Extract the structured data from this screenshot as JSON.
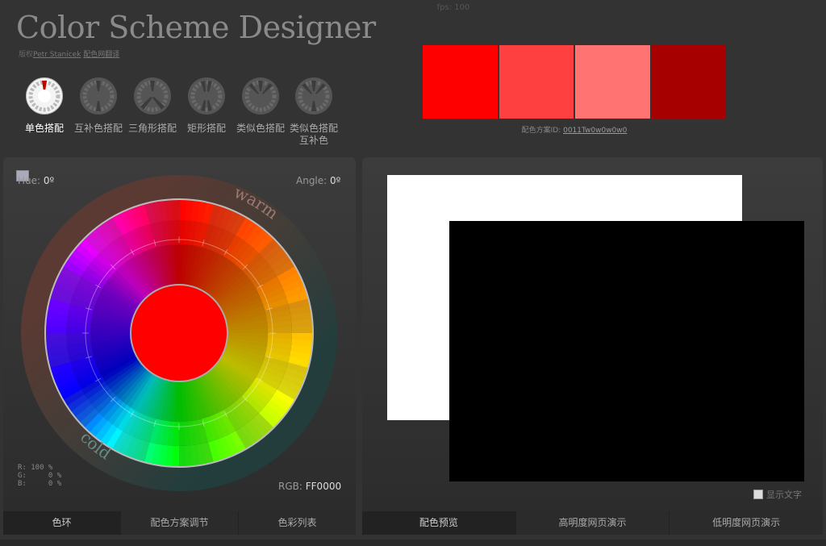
{
  "fps": "fps: 100",
  "app_title": "Color Scheme Designer",
  "credits": {
    "prefix": "版权",
    "author": "Petr Stanicek",
    "link": "配色网翻译"
  },
  "modes": [
    {
      "label": "单色搭配",
      "active": true
    },
    {
      "label": "互补色搭配",
      "active": false
    },
    {
      "label": "三角形搭配",
      "active": false
    },
    {
      "label": "矩形搭配",
      "active": false
    },
    {
      "label": "类似色搭配",
      "active": false
    },
    {
      "label": "类似色搭配互补色",
      "active": false
    }
  ],
  "palette": [
    "#FF0000",
    "#FF4040",
    "#FF7373",
    "#A60000"
  ],
  "scheme_id": {
    "label": "配色方案ID:",
    "value": "0011Tw0w0w0w0"
  },
  "wheel": {
    "hue_label": "Hue:",
    "hue_value": "0º",
    "angle_label": "Angle:",
    "angle_value": "0º",
    "warm_label": "warm",
    "cold_label": "cold",
    "rgb_label": "RGB:",
    "rgb_value": "FF0000",
    "r_line": "R: 100 %",
    "g_line": "G:     0 %",
    "b_line": "B:     0 %",
    "center_color": "#FF0000"
  },
  "left_tabs": [
    {
      "label": "色环",
      "active": true
    },
    {
      "label": "配色方案调节",
      "active": false
    },
    {
      "label": "色彩列表",
      "active": false
    }
  ],
  "right_tabs": [
    {
      "label": "配色预览",
      "active": true
    },
    {
      "label": "高明度网页演示",
      "active": false
    },
    {
      "label": "低明度网页演示",
      "active": false
    }
  ],
  "show_text_label": "显示文字"
}
